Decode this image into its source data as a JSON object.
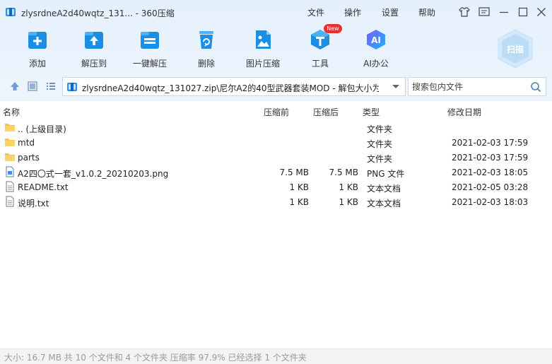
{
  "window": {
    "title": "zlysrdneA2d40wqtz_131... - 360压缩",
    "menu": [
      "文件",
      "操作",
      "设置",
      "帮助"
    ]
  },
  "toolbar": {
    "items": [
      {
        "label": "添加",
        "icon": "add-icon"
      },
      {
        "label": "解压到",
        "icon": "extract-to-icon"
      },
      {
        "label": "一键解压",
        "icon": "one-click-extract-icon"
      },
      {
        "label": "删除",
        "icon": "delete-icon"
      },
      {
        "label": "图片压缩",
        "icon": "image-compress-icon"
      },
      {
        "label": "工具",
        "icon": "tools-icon",
        "badge": "New"
      },
      {
        "label": "AI办公",
        "icon": "ai-office-icon",
        "icon_text": "AI"
      }
    ],
    "scan_label": "扫描"
  },
  "pathbar": {
    "path": "zlysrdneA2d40wqtz_131027.zip\\尼尔A2的40型武器套装MOD - 解包大小为",
    "search_placeholder": "搜索包内文件"
  },
  "columns": {
    "name": "名称",
    "size": "压缩前",
    "packed": "压缩后",
    "type": "类型",
    "modified": "修改日期"
  },
  "files": [
    {
      "name": ".. (上级目录)",
      "size": "",
      "packed": "",
      "type": "文件夹",
      "modified": "",
      "icon": "folder-up-icon"
    },
    {
      "name": "mtd",
      "size": "",
      "packed": "",
      "type": "文件夹",
      "modified": "2021-02-03 17:59",
      "icon": "folder-icon"
    },
    {
      "name": "parts",
      "size": "",
      "packed": "",
      "type": "文件夹",
      "modified": "2021-02-03 17:59",
      "icon": "folder-icon"
    },
    {
      "name": "A2四〇式一套_v1.0.2_20210203.png",
      "size": "7.5 MB",
      "packed": "7.5 MB",
      "type": "PNG 文件",
      "modified": "2021-02-03 18:05",
      "icon": "image-file-icon"
    },
    {
      "name": "README.txt",
      "size": "1 KB",
      "packed": "1 KB",
      "type": "文本文档",
      "modified": "2021-02-05 03:28",
      "icon": "text-file-icon"
    },
    {
      "name": "说明.txt",
      "size": "1 KB",
      "packed": "1 KB",
      "type": "文本文档",
      "modified": "2021-02-03 18:03",
      "icon": "text-file-icon"
    }
  ],
  "status": "大小: 16.7 MB 共 10 个文件和 4 个文件夹 压缩率 97.9% 已经选择 1 个文件夹",
  "colors": {
    "toolbar_bg": "#e6f1fc",
    "icon_blue": "#1b8fe6",
    "folder_yellow": "#f6c445",
    "new_badge": "#ee2e2e"
  }
}
